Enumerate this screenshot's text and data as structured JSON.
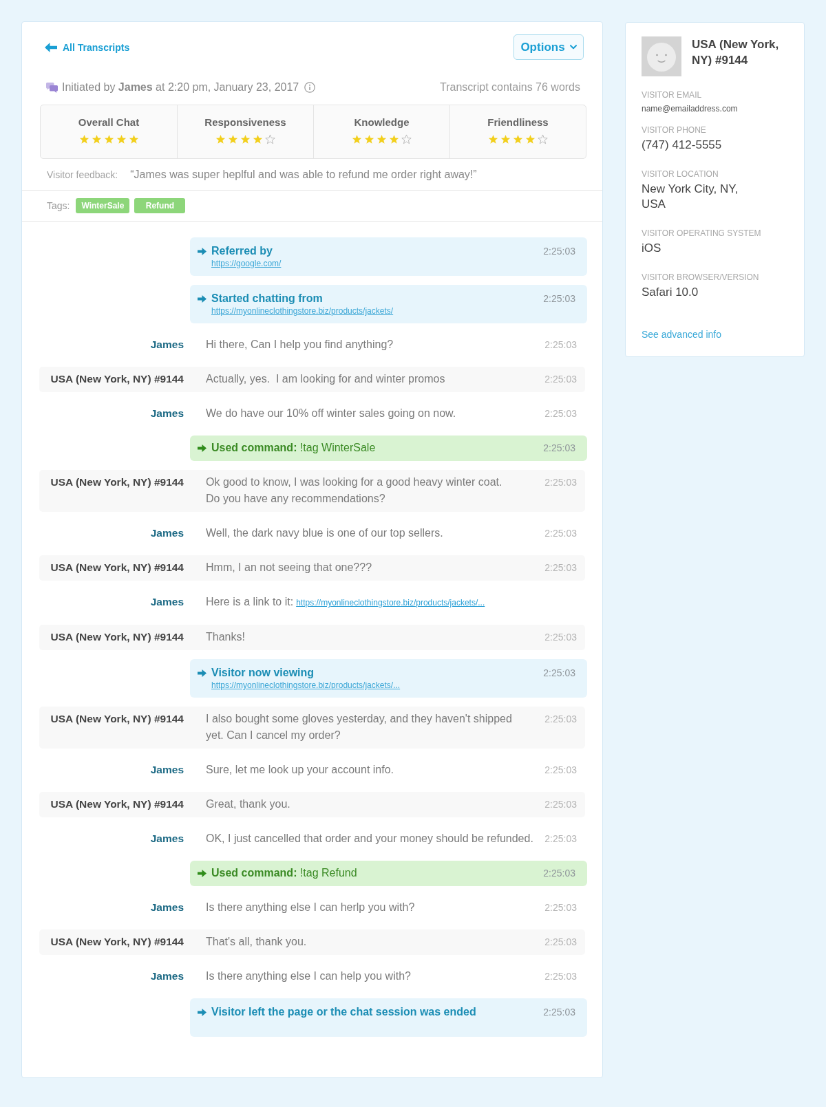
{
  "header": {
    "back_link": "All Transcripts",
    "options_button": "Options"
  },
  "summary": {
    "initiated": "Initiated by **James** at 2:20 pm, January 23, 2017",
    "word_count": "Transcript contains 76 words"
  },
  "ratings": [
    {
      "label": "Overall Chat",
      "stars": 5
    },
    {
      "label": "Responsiveness",
      "stars": 4
    },
    {
      "label": "Knowledge",
      "stars": 4
    },
    {
      "label": "Friendliness",
      "stars": 4
    }
  ],
  "feedback": {
    "label": "Visitor feedback:",
    "text": "“James was super heplful and was able to refund me order right away!”"
  },
  "tags": {
    "label": "Tags:",
    "items": [
      "WinterSale",
      "Refund"
    ]
  },
  "messages": [
    {
      "kind": "event",
      "title": "Referred by",
      "link": "https://google.com/",
      "time": "2:25:03"
    },
    {
      "kind": "event",
      "title": "Started chatting from",
      "link": "https://myonlineclothingstore.biz/products/jackets/",
      "time": "2:25:03"
    },
    {
      "kind": "agent",
      "sender": "James",
      "text": "Hi there, Can I help you find anything?",
      "time": "2:25:03"
    },
    {
      "kind": "visitor",
      "sender": "USA (New York, NY) #9144",
      "text": "Actually, yes.  I am looking for and winter promos",
      "time": "2:25:03"
    },
    {
      "kind": "agent",
      "sender": "James",
      "text": "We do have our 10% off winter sales going on now.",
      "time": "2:25:03"
    },
    {
      "kind": "command",
      "text": "**Used command:** !tag WinterSale",
      "time": "2:25:03"
    },
    {
      "kind": "visitor",
      "sender": "USA (New York, NY) #9144",
      "text": "Ok good to know, I was looking for a good heavy winter coat. Do you have any recommendations?",
      "time": "2:25:03"
    },
    {
      "kind": "agent",
      "sender": "James",
      "text": "Well, the dark navy blue is one of our top sellers.",
      "time": "2:25:03"
    },
    {
      "kind": "visitor",
      "sender": "USA (New York, NY) #9144",
      "text": "Hmm, I an not seeing that one???",
      "time": "2:25:03"
    },
    {
      "kind": "agent",
      "sender": "James",
      "text": "Here is a link to it:",
      "link": "https://myonlineclothingstore.biz/products/jackets/..."
    },
    {
      "kind": "visitor",
      "sender": "USA (New York, NY) #9144",
      "text": "Thanks!",
      "time": "2:25:03"
    },
    {
      "kind": "event",
      "title": "Visitor now viewing",
      "link": "https://myonlineclothingstore.biz/products/jackets/...",
      "time": "2:25:03"
    },
    {
      "kind": "visitor",
      "sender": "USA (New York, NY) #9144",
      "text": "I also bought some gloves yesterday, and they haven't shipped yet. Can I cancel my order?",
      "time": "2:25:03"
    },
    {
      "kind": "agent",
      "sender": "James",
      "text": "Sure, let me look up your account info.",
      "time": "2:25:03"
    },
    {
      "kind": "visitor",
      "sender": "USA (New York, NY) #9144",
      "text": "Great, thank you.",
      "time": "2:25:03"
    },
    {
      "kind": "agent",
      "sender": "James",
      "text": "OK, I just cancelled that order and your money should be refunded.",
      "time": "2:25:03"
    },
    {
      "kind": "command",
      "text": "**Used command:** !tag Refund",
      "time": "2:25:03"
    },
    {
      "kind": "agent",
      "sender": "James",
      "text": "Is there anything else I can herlp you with?",
      "time": "2:25:03"
    },
    {
      "kind": "visitor",
      "sender": "USA (New York, NY) #9144",
      "text": "That's all, thank you.",
      "time": "2:25:03"
    },
    {
      "kind": "agent",
      "sender": "James",
      "text": "Is there anything else I can help you with?",
      "time": "2:25:03"
    },
    {
      "kind": "event",
      "title": "Visitor left the page or the chat session was ended",
      "time": "2:25:03"
    }
  ],
  "visitor": {
    "name": "USA (New York, NY) #9144",
    "email": {
      "label": "VISITOR EMAIL",
      "value": "name@emailaddress.com"
    },
    "fields": [
      {
        "label": "VISITOR PHONE",
        "value": "(747) 412-5555"
      },
      {
        "label": "VISITOR LOCATION",
        "value": "New York City, NY,\nUSA"
      },
      {
        "label": "VISITOR OPERATING SYSTEM",
        "value": "iOS"
      },
      {
        "label": "VISITOR BROWSER/VERSION",
        "value": "Safari 10.0"
      }
    ],
    "advanced_link": "See advanced info"
  }
}
